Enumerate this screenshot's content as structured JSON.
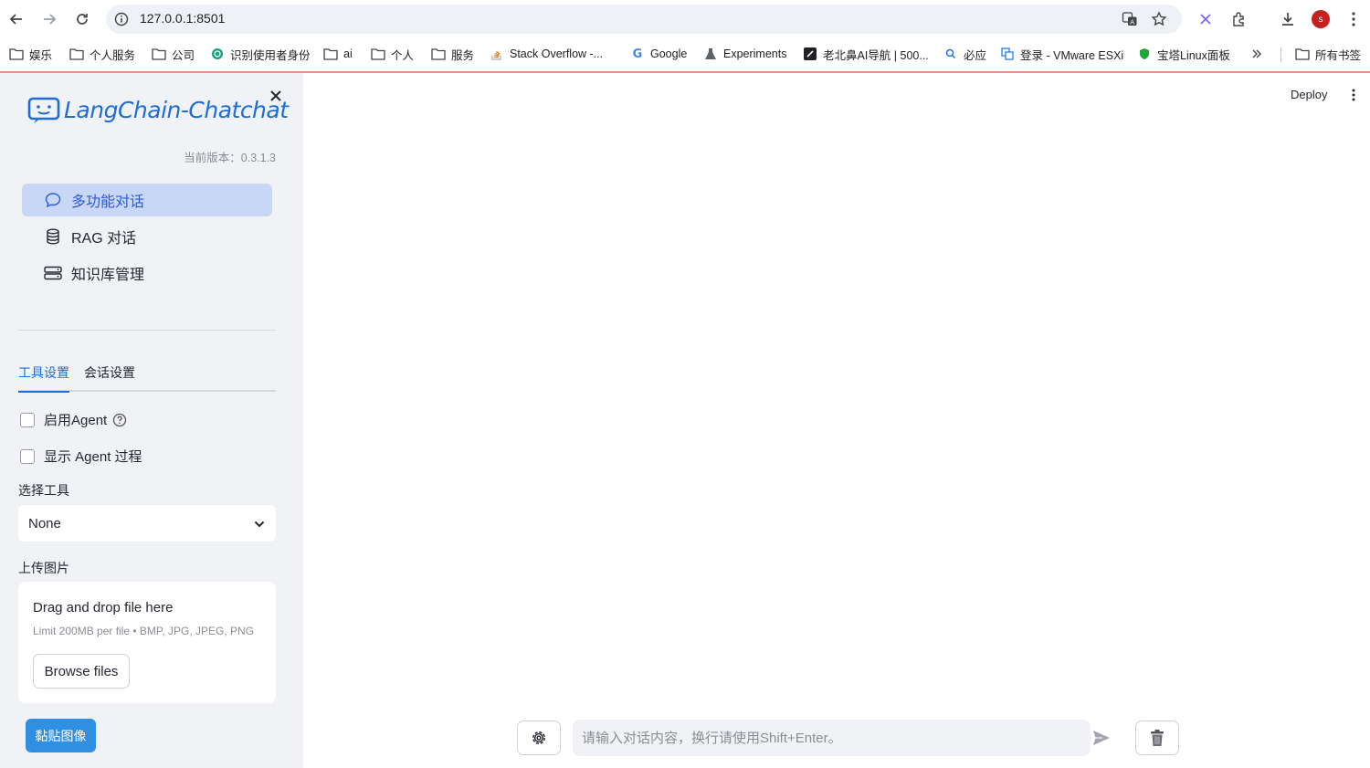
{
  "browser": {
    "url": "127.0.0.1:8501",
    "avatar_letter": "s",
    "bookmarks": [
      {
        "label": "娱乐",
        "icon": "folder-icon"
      },
      {
        "label": "个人服务",
        "icon": "folder-icon"
      },
      {
        "label": "公司",
        "icon": "folder-icon"
      },
      {
        "label": "识别使用者身份",
        "icon": "openai-icon"
      },
      {
        "label": "ai",
        "icon": "folder-icon"
      },
      {
        "label": "个人",
        "icon": "folder-icon"
      },
      {
        "label": "服务",
        "icon": "folder-icon"
      },
      {
        "label": "Stack Overflow -...",
        "icon": "stackoverflow-icon"
      },
      {
        "label": "Google",
        "icon": "google-icon"
      },
      {
        "label": "Experiments",
        "icon": "flask-icon"
      },
      {
        "label": "老北鼻AI导航 | 500...",
        "icon": "site-icon"
      },
      {
        "label": "必应",
        "icon": "bing-icon"
      },
      {
        "label": "登录 - VMware ESXi",
        "icon": "vmware-icon"
      },
      {
        "label": "宝塔Linux面板",
        "icon": "shield-icon"
      }
    ],
    "all_bookmarks_label": "所有书签"
  },
  "sidebar": {
    "logo_text": "LangChain-Chatchat",
    "version": "当前版本：0.3.1.3",
    "menu": [
      {
        "label": "多功能对话",
        "icon": "chat-bubble-icon",
        "active": true
      },
      {
        "label": "RAG 对话",
        "icon": "database-icon",
        "active": false
      },
      {
        "label": "知识库管理",
        "icon": "hdd-stack-icon",
        "active": false
      }
    ],
    "tabs": [
      {
        "label": "工具设置",
        "active": true
      },
      {
        "label": "会话设置",
        "active": false
      }
    ],
    "enable_agent_label": "启用Agent",
    "show_agent_process_label": "显示 Agent 过程",
    "select_tool_label": "选择工具",
    "select_tool_value": "None",
    "upload_label": "上传图片",
    "upload_title": "Drag and drop file here",
    "upload_limit": "Limit 200MB per file • BMP, JPG, JPEG, PNG",
    "browse_label": "Browse files",
    "paste_label": "黏贴图像"
  },
  "main": {
    "deploy_label": "Deploy",
    "chat_placeholder": "请输入对话内容，换行请使用Shift+Enter。"
  },
  "colors": {
    "accent": "#1e6dd8",
    "active_menu_bg": "#c7d7f5",
    "sidebar_bg": "#f0f2f6",
    "paste_button": "#2f8fe0",
    "avatar": "#c5221f"
  }
}
